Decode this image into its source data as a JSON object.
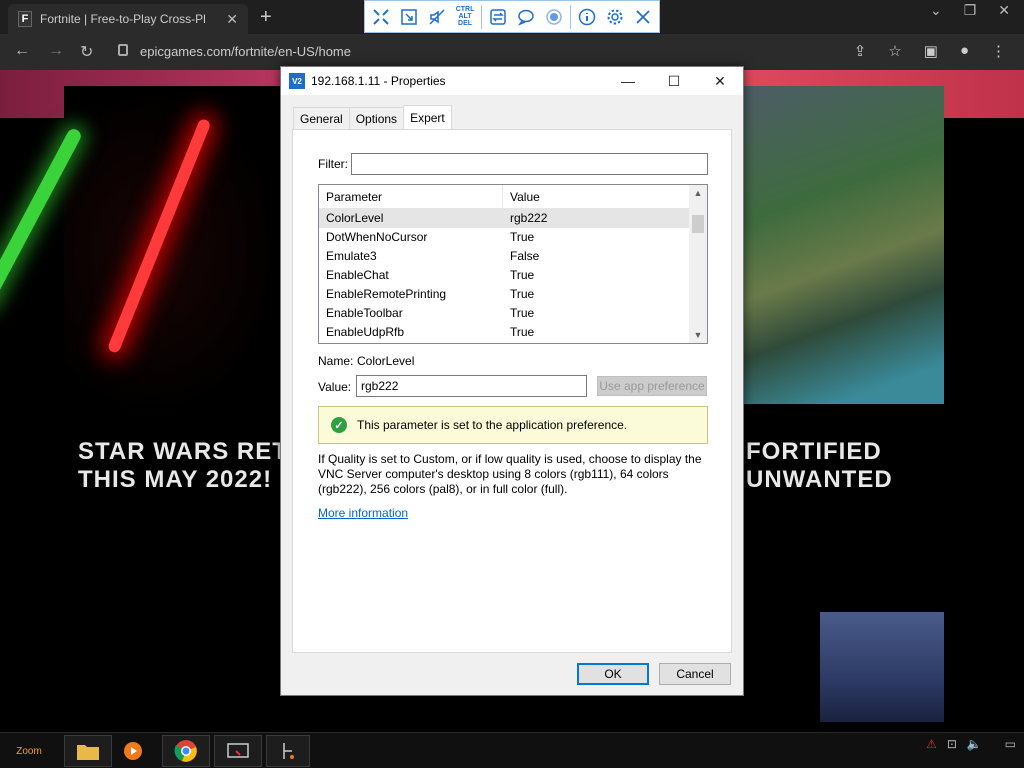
{
  "browser": {
    "tab_title": "Fortnite | Free-to-Play Cross-Pl",
    "tab_favicon": "F",
    "url": "epicgames.com/fortnite/en-US/home"
  },
  "web": {
    "headline_left_1": "STAR WARS RETU",
    "headline_left_2": "THIS MAY 2022!",
    "headline_right_1": "FORTIFIED",
    "headline_right_2": "UNWANTED"
  },
  "dialog": {
    "title": "192.168.1.11 - Properties",
    "app_icon": "V2",
    "tabs": [
      {
        "label": "General"
      },
      {
        "label": "Options"
      },
      {
        "label": "Expert"
      }
    ],
    "filter_label": "Filter:",
    "filter_value": "",
    "list": {
      "col_parameter": "Parameter",
      "col_value": "Value",
      "rows": [
        {
          "param": "ColorLevel",
          "value": "rgb222"
        },
        {
          "param": "DotWhenNoCursor",
          "value": "True"
        },
        {
          "param": "Emulate3",
          "value": "False"
        },
        {
          "param": "EnableChat",
          "value": "True"
        },
        {
          "param": "EnableRemotePrinting",
          "value": "True"
        },
        {
          "param": "EnableToolbar",
          "value": "True"
        },
        {
          "param": "EnableUdpRfb",
          "value": "True"
        }
      ]
    },
    "name_label": "Name:",
    "name_value": "ColorLevel",
    "value_label": "Value:",
    "value_value": "rgb222",
    "use_app_pref_button": "Use app preference",
    "info_message": "This parameter is set to the application preference.",
    "description": "If Quality is set to Custom, or if low quality is used, choose to display the VNC Server computer's desktop using 8 colors (rgb111), 64 colors (rgb222), 256 colors (pal8), or in full color (full).",
    "more_info_link": "More information",
    "ok_button": "OK",
    "cancel_button": "Cancel"
  },
  "vnc_toolbar": {
    "ctrl_alt_del": "CTRL ALT DEL"
  },
  "taskbar": {
    "start_label": "Zoom"
  },
  "colors": {
    "accent": "#0078d7",
    "link": "#0066cc",
    "info_bg": "#fbfbd9",
    "info_icon": "#2ea043"
  }
}
